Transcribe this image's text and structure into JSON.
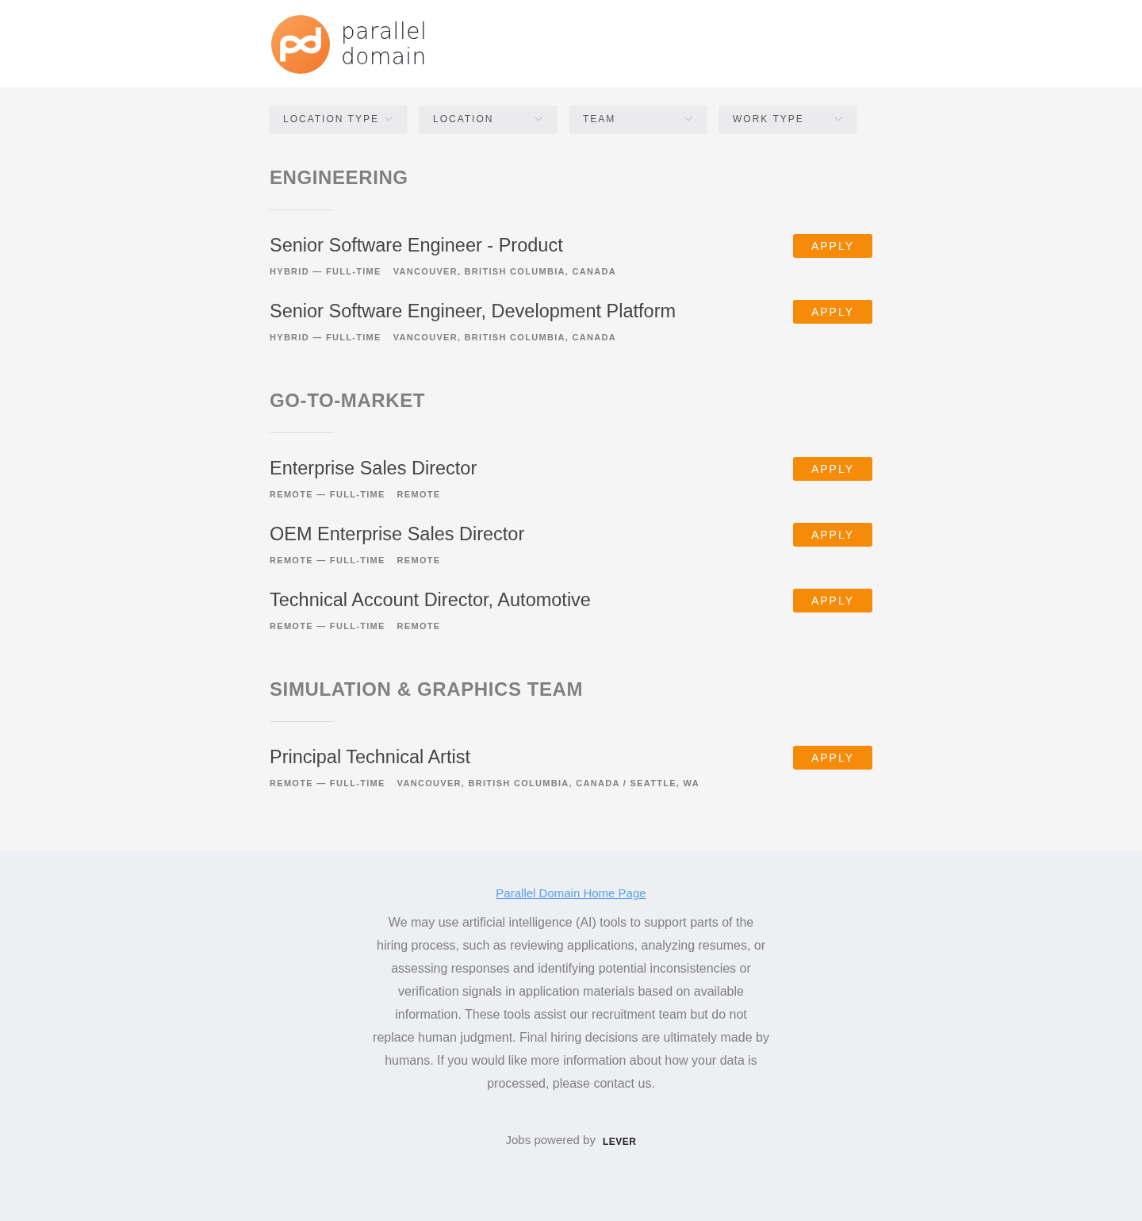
{
  "header": {
    "logo_wordmark": [
      "parallel",
      "domain"
    ]
  },
  "filters": [
    {
      "label": "LOCATION TYPE"
    },
    {
      "label": "LOCATION"
    },
    {
      "label": "TEAM"
    },
    {
      "label": "WORK TYPE"
    }
  ],
  "sections": [
    {
      "title": "ENGINEERING",
      "jobs": [
        {
          "title": "Senior Software Engineer - Product",
          "commitment": "HYBRID — FULL-TIME",
          "location": "VANCOUVER, BRITISH COLUMBIA, CANADA",
          "apply_label": "APPLY"
        },
        {
          "title": "Senior Software Engineer, Development Platform",
          "commitment": "HYBRID — FULL-TIME",
          "location": "VANCOUVER, BRITISH COLUMBIA, CANADA",
          "apply_label": "APPLY"
        }
      ]
    },
    {
      "title": "GO-TO-MARKET",
      "jobs": [
        {
          "title": "Enterprise Sales Director",
          "commitment": "REMOTE — FULL-TIME",
          "location": "REMOTE",
          "apply_label": "APPLY"
        },
        {
          "title": "OEM Enterprise Sales Director",
          "commitment": "REMOTE — FULL-TIME",
          "location": "REMOTE",
          "apply_label": "APPLY"
        },
        {
          "title": "Technical Account Director, Automotive",
          "commitment": "REMOTE — FULL-TIME",
          "location": "REMOTE",
          "apply_label": "APPLY"
        }
      ]
    },
    {
      "title": "SIMULATION & GRAPHICS TEAM",
      "jobs": [
        {
          "title": "Principal Technical Artist",
          "commitment": "REMOTE — FULL-TIME",
          "location": "VANCOUVER, BRITISH COLUMBIA, CANADA / SEATTLE, WA",
          "apply_label": "APPLY"
        }
      ]
    }
  ],
  "footer": {
    "link": "Parallel Domain Home Page",
    "notice": "We may use artificial intelligence (AI) tools to support parts of the hiring process, such as reviewing applications, analyzing resumes, or assessing responses and identifying potential inconsistencies or verification signals in application materials based on available information. These tools assist our recruitment team but do not replace human judgment. Final hiring decisions are ultimately made by humans. If you would like more information about how your data is processed, please contact us.",
    "powered_by": "Jobs powered by",
    "powered_by_brand": "LEVER"
  }
}
